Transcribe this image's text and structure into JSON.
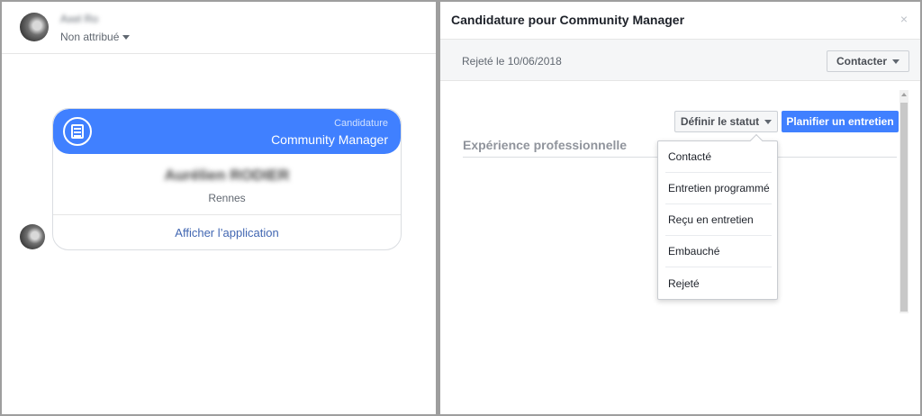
{
  "left_panel": {
    "user_name": "Axel Ro",
    "assignment": "Non attribué",
    "card": {
      "kicker": "Candidature",
      "title": "Community Manager",
      "applicant_name": "Aurélien RODIER",
      "city": "Rennes",
      "link": "Afficher l’application"
    }
  },
  "dialog": {
    "title": "Candidature pour Community Manager",
    "close": "×",
    "rejected_label": "Rejeté le 10/06/2018",
    "contact_button": "Contacter",
    "status_button": "Définir le statut",
    "plan_button": "Planifier un entretien",
    "section_title": "Expérience professionnelle",
    "status_menu": [
      "Contacté",
      "Entretien programmé",
      "Reçu en entretien",
      "Embauché",
      "Rejeté"
    ]
  },
  "colors": {
    "accent": "#4080ff",
    "link": "#4267b2"
  }
}
